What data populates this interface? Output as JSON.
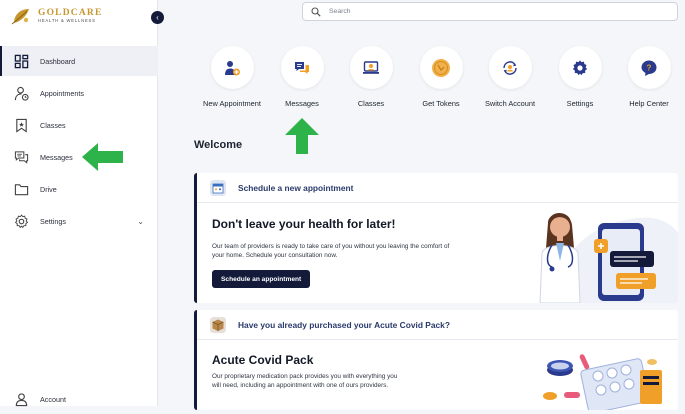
{
  "brand": {
    "name": "GOLDCARE",
    "tagline": "HEALTH & WELLNESS"
  },
  "sidebar": {
    "items": [
      {
        "label": "Dashboard",
        "icon": "dashboard-icon",
        "active": true
      },
      {
        "label": "Appointments",
        "icon": "appointments-icon"
      },
      {
        "label": "Classes",
        "icon": "bookmark-icon"
      },
      {
        "label": "Messages",
        "icon": "messages-icon"
      },
      {
        "label": "Drive",
        "icon": "folder-icon"
      },
      {
        "label": "Settings",
        "icon": "gear-icon"
      }
    ],
    "account_label": "Account"
  },
  "search": {
    "placeholder": "Search"
  },
  "shortcuts": [
    {
      "label": "New Appointment",
      "icon": "new-appointment-icon"
    },
    {
      "label": "Messages",
      "icon": "messages-icon"
    },
    {
      "label": "Classes",
      "icon": "classes-icon"
    },
    {
      "label": "Get Tokens",
      "icon": "tokens-icon"
    },
    {
      "label": "Switch Account",
      "icon": "switch-account-icon"
    },
    {
      "label": "Settings",
      "icon": "gear-icon"
    },
    {
      "label": "Help Center",
      "icon": "help-icon"
    }
  ],
  "welcome": "Welcome",
  "cards": [
    {
      "header": "Schedule a new appointment",
      "title": "Don't leave your health for later!",
      "body": "Our team of providers is ready to take care of you without you leaving the comfort of your home. Schedule your consultation now.",
      "button": "Schedule an appointment"
    },
    {
      "header": "Have you already purchased your Acute Covid Pack?",
      "title": "Acute Covid Pack",
      "body": "Our proprietary medication pack provides you with everything you will need, including an appointment with one of ours providers."
    }
  ],
  "colors": {
    "brand_gold": "#c8962e",
    "navy": "#131a3a",
    "annotation_arrow": "#2db34a"
  }
}
